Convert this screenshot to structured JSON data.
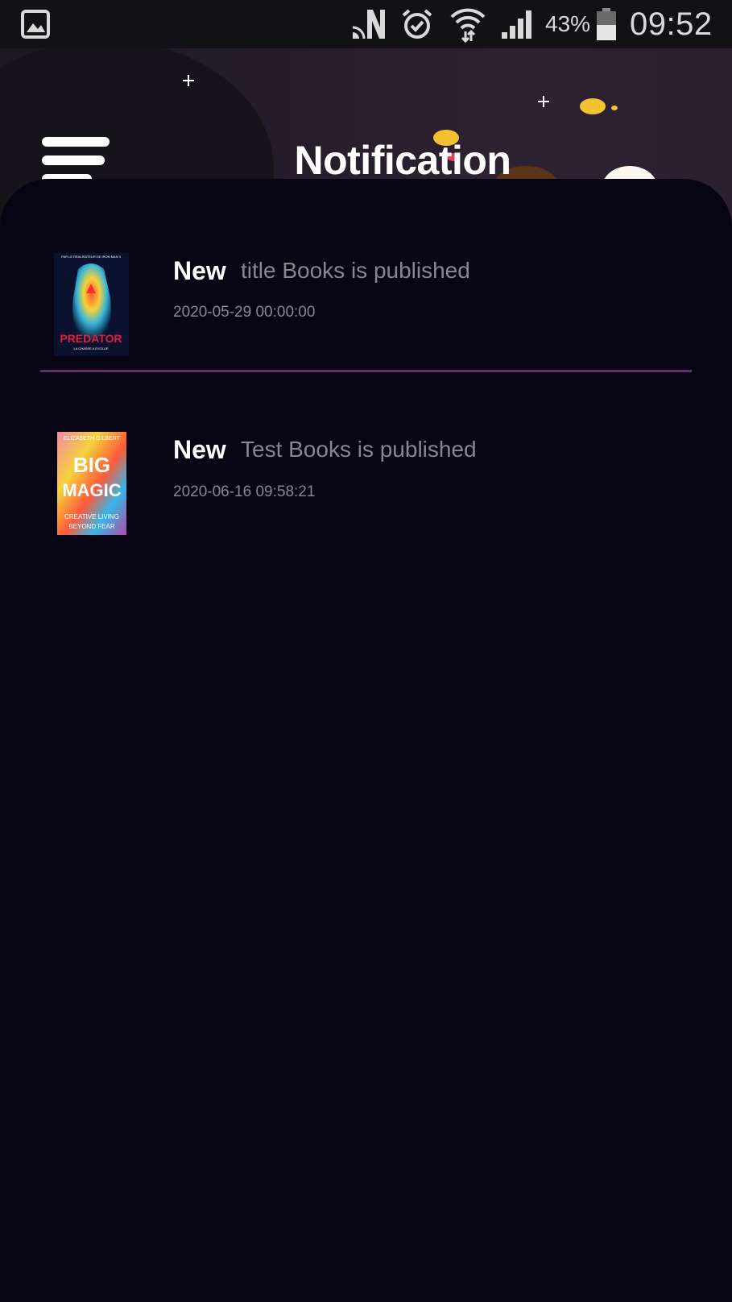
{
  "status_bar": {
    "battery_percent": "43%",
    "time": "09:52",
    "icons": [
      "gallery-icon",
      "n-icon",
      "alarm-icon",
      "wifi-icon",
      "signal-icon",
      "battery-icon"
    ]
  },
  "header": {
    "title": "Notification",
    "menu_icon": "menu-icon",
    "illustration": "boy-with-bell-cloud"
  },
  "notifications": [
    {
      "badge": "New",
      "message": "title Books is published",
      "date": "2020-05-29 00:00:00",
      "cover": {
        "title": "PREDATOR",
        "top_text": "PAR LE REALISATEUR DE IRON MAN 3",
        "sub_text": "LA CHASSE A EVOLUE"
      }
    },
    {
      "badge": "New",
      "message": "Test Books is published",
      "date": "2020-06-16 09:58:21",
      "cover": {
        "author": "ELIZABETH GILBERT",
        "title_line1": "BIG",
        "title_line2": "MAGIC",
        "sub_line1": "CREATIVE LIVING",
        "sub_line2": "BEYOND FEAR"
      }
    }
  ],
  "colors": {
    "background": "#070414",
    "divider": "#6a2b75",
    "secondary_text": "#8a8690"
  }
}
